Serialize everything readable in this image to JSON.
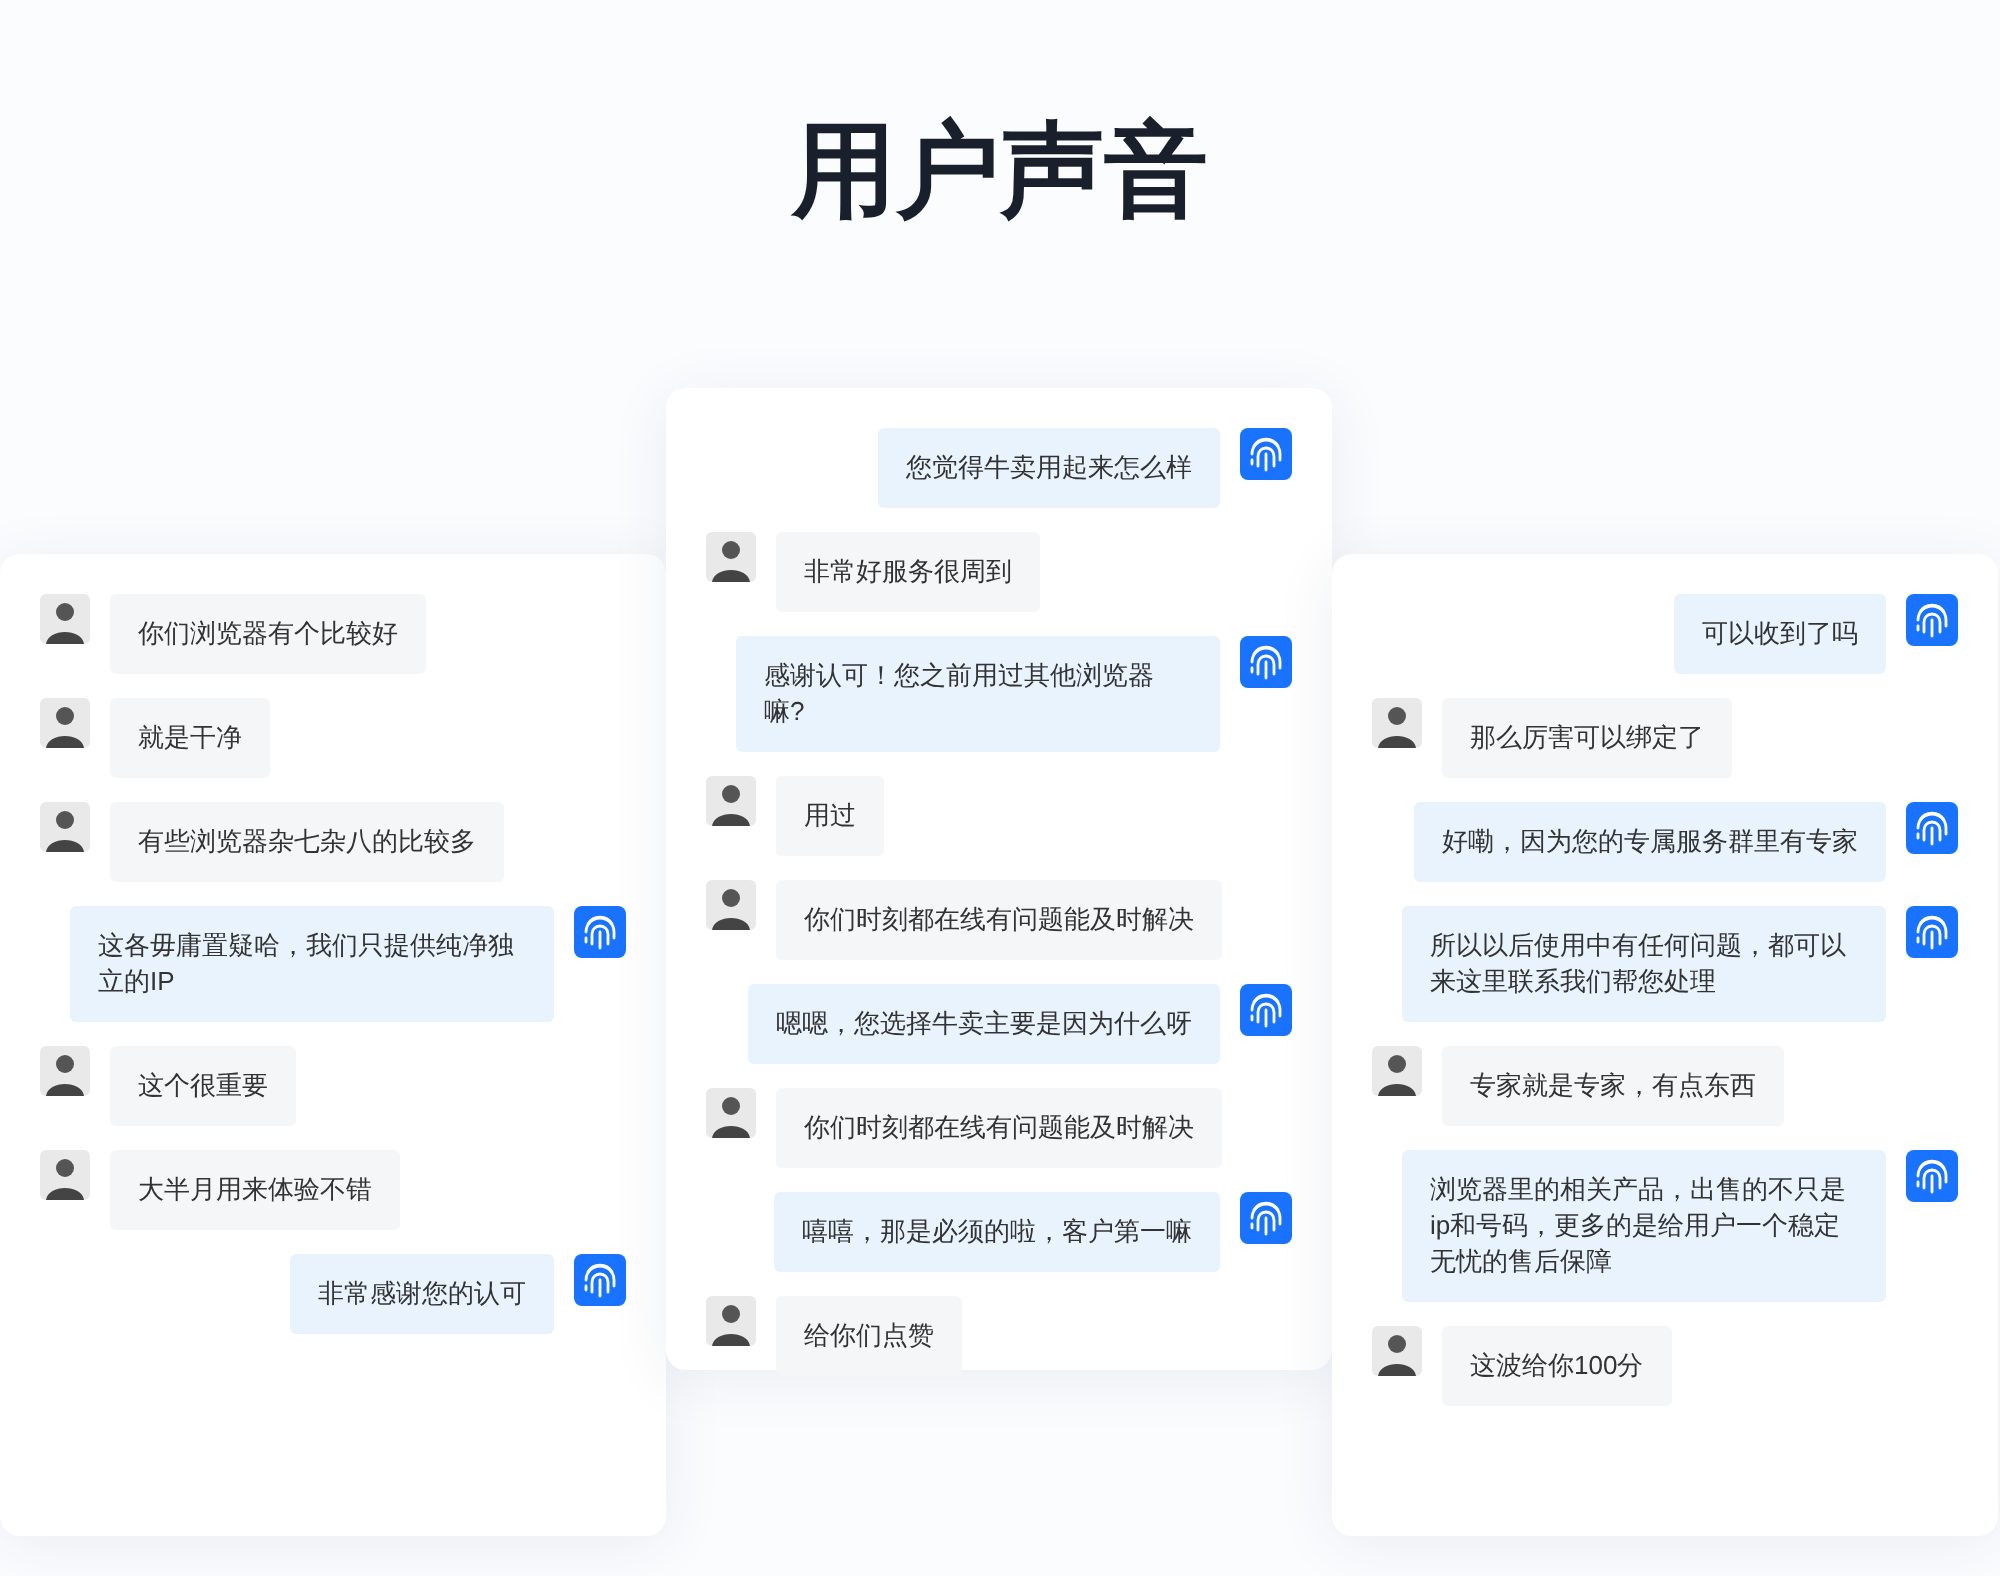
{
  "title": "用户声音",
  "chats": [
    {
      "messages": [
        {
          "kind": "customer",
          "text": "你们浏览器有个比较好"
        },
        {
          "kind": "customer",
          "text": "就是干净"
        },
        {
          "kind": "customer",
          "text": "有些浏览器杂七杂八的比较多"
        },
        {
          "kind": "agent",
          "text": "这各毋庸置疑哈，我们只提供纯净独立的IP"
        },
        {
          "kind": "customer",
          "text": "这个很重要"
        },
        {
          "kind": "customer",
          "text": "大半月用来体验不错"
        },
        {
          "kind": "agent",
          "text": "非常感谢您的认可"
        }
      ]
    },
    {
      "messages": [
        {
          "kind": "agent",
          "text": "您觉得牛卖用起来怎么样"
        },
        {
          "kind": "customer",
          "text": "非常好服务很周到"
        },
        {
          "kind": "agent",
          "text": "感谢认可！您之前用过其他浏览器嘛?"
        },
        {
          "kind": "customer",
          "text": "用过"
        },
        {
          "kind": "customer",
          "text": "你们时刻都在线有问题能及时解决"
        },
        {
          "kind": "agent",
          "text": "嗯嗯，您选择牛卖主要是因为什么呀"
        },
        {
          "kind": "customer",
          "text": "你们时刻都在线有问题能及时解决"
        },
        {
          "kind": "agent",
          "text": "嘻嘻，那是必须的啦，客户第一嘛"
        },
        {
          "kind": "customer",
          "text": "给你们点赞"
        }
      ]
    },
    {
      "messages": [
        {
          "kind": "agent",
          "text": "可以收到了吗"
        },
        {
          "kind": "customer",
          "text": "那么厉害可以绑定了"
        },
        {
          "kind": "agent",
          "text": "好嘞，因为您的专属服务群里有专家"
        },
        {
          "kind": "agent",
          "text": "所以以后使用中有任何问题，都可以来这里联系我们帮您处理"
        },
        {
          "kind": "customer",
          "text": "专家就是专家，有点东西"
        },
        {
          "kind": "agent",
          "text": "浏览器里的相关产品，出售的不只是ip和号码，更多的是给用户一个稳定无忧的售后保障"
        },
        {
          "kind": "customer",
          "text": "这波给你100分"
        }
      ]
    }
  ]
}
